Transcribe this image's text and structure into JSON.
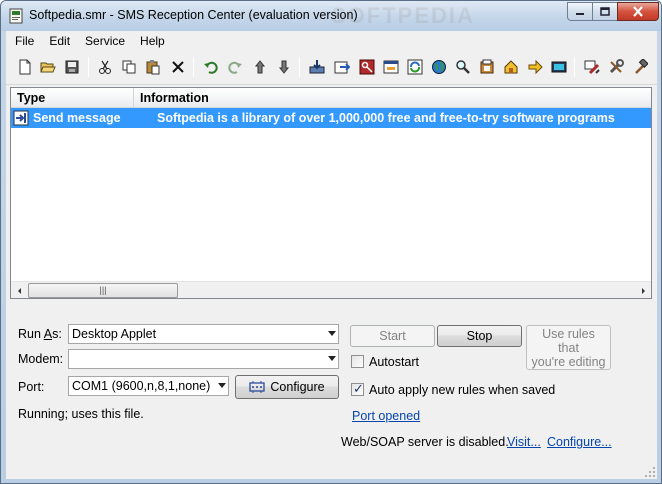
{
  "window": {
    "title": "Softpedia.smr  -  SMS Reception Center (evaluation version)",
    "watermark": "SOFTPEDIA"
  },
  "menu": [
    "File",
    "Edit",
    "Service",
    "Help"
  ],
  "toolbar": {
    "icons": [
      "new-file-icon",
      "open-folder-icon",
      "save-icon",
      "cut-icon",
      "copy-icon",
      "paste-icon",
      "delete-icon",
      "undo-icon",
      "redo-icon",
      "move-up-icon",
      "move-down-icon",
      "import-icon",
      "export-icon",
      "key-icon",
      "window-icon",
      "refresh-icon",
      "globe-icon",
      "find-icon",
      "properties-icon",
      "home-icon",
      "arrow-right-icon",
      "screen-icon",
      "tools-icon",
      "wrench-icon",
      "hammer-icon"
    ]
  },
  "list": {
    "columns": [
      "Type",
      "Information"
    ],
    "rows": [
      {
        "type": "Send message",
        "info": "Softpedia is a library of over 1,000,000 free and free-to-try software programs"
      }
    ],
    "scroll_grip": "|||"
  },
  "controls": {
    "run_as_label_pre": "Run ",
    "run_as_label_key": "A",
    "run_as_label_post": "s:",
    "run_as_value": "Desktop Applet",
    "modem_label": "Modem:",
    "modem_value": "",
    "port_label": "Port:",
    "port_value": "COM1 (9600,n,8,1,none)",
    "configure_label": "Configure",
    "start_label": "Start",
    "stop_label": "Stop",
    "hint_line1": "Use rules that",
    "hint_line2": "you're editing",
    "autostart_label": "Autostart",
    "autostart_checked": false,
    "auto_apply_label": "Auto apply new rules when saved",
    "auto_apply_checked": true,
    "status_text": "Running;  uses this file.",
    "port_status_link": "Port opened",
    "server_status": "Web/SOAP server is disabled.",
    "visit_link": "Visit...",
    "configure_link": "Configure..."
  },
  "colors": {
    "selection": "#3399ff",
    "link": "#0645ad"
  }
}
